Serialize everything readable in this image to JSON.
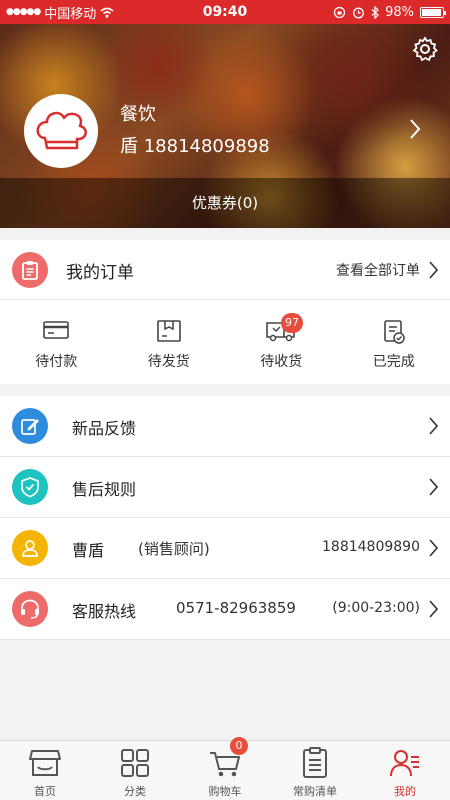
{
  "status_bar": {
    "carrier": "中国移动",
    "time": "09:40",
    "battery": "98%"
  },
  "colors": {
    "brand_red": "#dc2a2a",
    "badge_red": "#e84c3d",
    "blue": "#2d8cde",
    "teal": "#1ec3c0",
    "yellow": "#f5b400",
    "pink": "#ee6b6b"
  },
  "profile": {
    "name": "餐饮",
    "phone": "盾 18814809898",
    "coupons": "优惠券(0)",
    "avatar_icon": "chef-hat-icon",
    "settings_icon": "gear-icon"
  },
  "orders": {
    "title": "我的订单",
    "view_all": "查看全部订单",
    "statuses": [
      {
        "label": "待付款",
        "icon": "card-icon",
        "badge": ""
      },
      {
        "label": "待发货",
        "icon": "box-icon",
        "badge": ""
      },
      {
        "label": "待收货",
        "icon": "truck-icon",
        "badge": "97"
      },
      {
        "label": "已完成",
        "icon": "checklist-icon",
        "badge": ""
      }
    ]
  },
  "menu": {
    "feedback": {
      "label": "新品反馈",
      "icon": "edit-icon"
    },
    "after_sale": {
      "label": "售后规则",
      "icon": "shield-icon"
    },
    "advisor": {
      "label": "曹盾",
      "sub": "(销售顾问)",
      "phone": "18814809890",
      "icon": "person-icon"
    },
    "hotline": {
      "label": "客服热线",
      "phone": "0571-82963859",
      "hours": "(9:00-23:00)",
      "icon": "headset-icon"
    }
  },
  "tabs": [
    {
      "label": "首页",
      "icon": "store-icon"
    },
    {
      "label": "分类",
      "icon": "grid-icon"
    },
    {
      "label": "购物车",
      "icon": "cart-icon",
      "badge": "0"
    },
    {
      "label": "常购清单",
      "icon": "list-icon"
    },
    {
      "label": "我的",
      "icon": "profile-icon"
    }
  ]
}
